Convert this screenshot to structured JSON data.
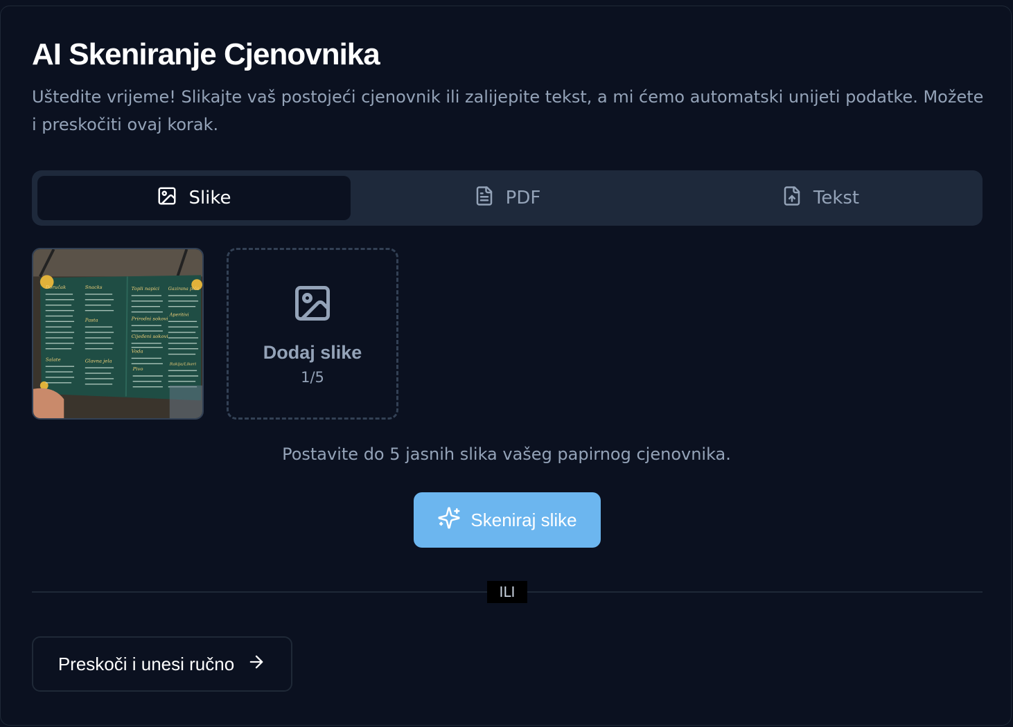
{
  "header": {
    "title": "AI Skeniranje Cjenovnika",
    "subtitle": "Uštedite vrijeme! Slikajte vaš postojeći cjenovnik ili zalijepite tekst, a mi ćemo automatski unijeti podatke. Možete i preskočiti ovaj korak."
  },
  "tabs": [
    {
      "label": "Slike",
      "icon": "image-icon",
      "active": true
    },
    {
      "label": "PDF",
      "icon": "file-text-icon",
      "active": false
    },
    {
      "label": "Tekst",
      "icon": "file-upload-icon",
      "active": false
    }
  ],
  "upload": {
    "thumbnail_icon": "menu-photo",
    "add_label": "Dodaj slike",
    "count": "1/5",
    "hint": "Postavite do 5 jasnih slika vašeg papirnog cjenovnika."
  },
  "actions": {
    "scan_label": "Skeniraj slike",
    "or_label": "ILI",
    "skip_label": "Preskoči i unesi ručno"
  },
  "menu_photo": {
    "headings": [
      "Doručak",
      "Snacks",
      "Topli napici",
      "Gazirana pića",
      "Prirodni sokovi",
      "Aperitivi",
      "Pasta",
      "Cijeđeni sokovi",
      "Salate",
      "Glavna jela",
      "Voda",
      "Rakija/Likeri",
      "Pivo"
    ]
  },
  "colors": {
    "background": "#0b1120",
    "accent": "#6cb6ef",
    "muted_text": "#94a3b8",
    "tab_bar": "#1e293b"
  }
}
